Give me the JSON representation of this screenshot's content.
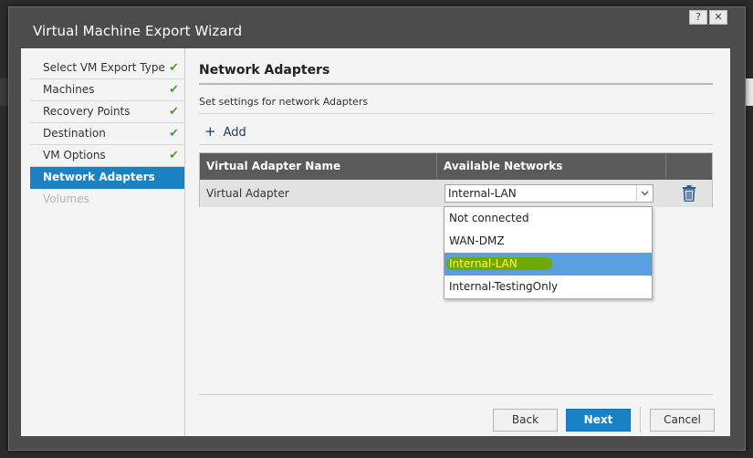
{
  "window": {
    "title": "Virtual Machine Export Wizard",
    "help_label": "?",
    "close_label": "✕",
    "background_fragment": "st"
  },
  "nav": {
    "items": [
      {
        "label": "Select VM Export Type",
        "state": "done"
      },
      {
        "label": "Machines",
        "state": "done"
      },
      {
        "label": "Recovery Points",
        "state": "done"
      },
      {
        "label": "Destination",
        "state": "done"
      },
      {
        "label": "VM Options",
        "state": "done"
      },
      {
        "label": "Network Adapters",
        "state": "active"
      },
      {
        "label": "Volumes",
        "state": "disabled"
      }
    ],
    "check_glyph": "✔"
  },
  "main": {
    "title": "Network Adapters",
    "description": "Set settings for network Adapters",
    "add_label": "Add",
    "add_icon": "+",
    "table": {
      "columns": [
        "Virtual Adapter Name",
        "Available Networks",
        ""
      ],
      "rows": [
        {
          "name": "Virtual Adapter",
          "network": "Internal-LAN"
        }
      ]
    },
    "dropdown": {
      "options": [
        "Not connected",
        "WAN-DMZ",
        "Internal-LAN",
        "Internal-TestingOnly"
      ],
      "selected_index": 2
    }
  },
  "footer": {
    "back_label": "Back",
    "next_label": "Next",
    "cancel_label": "Cancel"
  },
  "colors": {
    "accent": "#1a82c4",
    "check": "#5a9e2f",
    "dropdown_selected": "#5a9fdf",
    "highlight_marker": "#6fa80a"
  }
}
